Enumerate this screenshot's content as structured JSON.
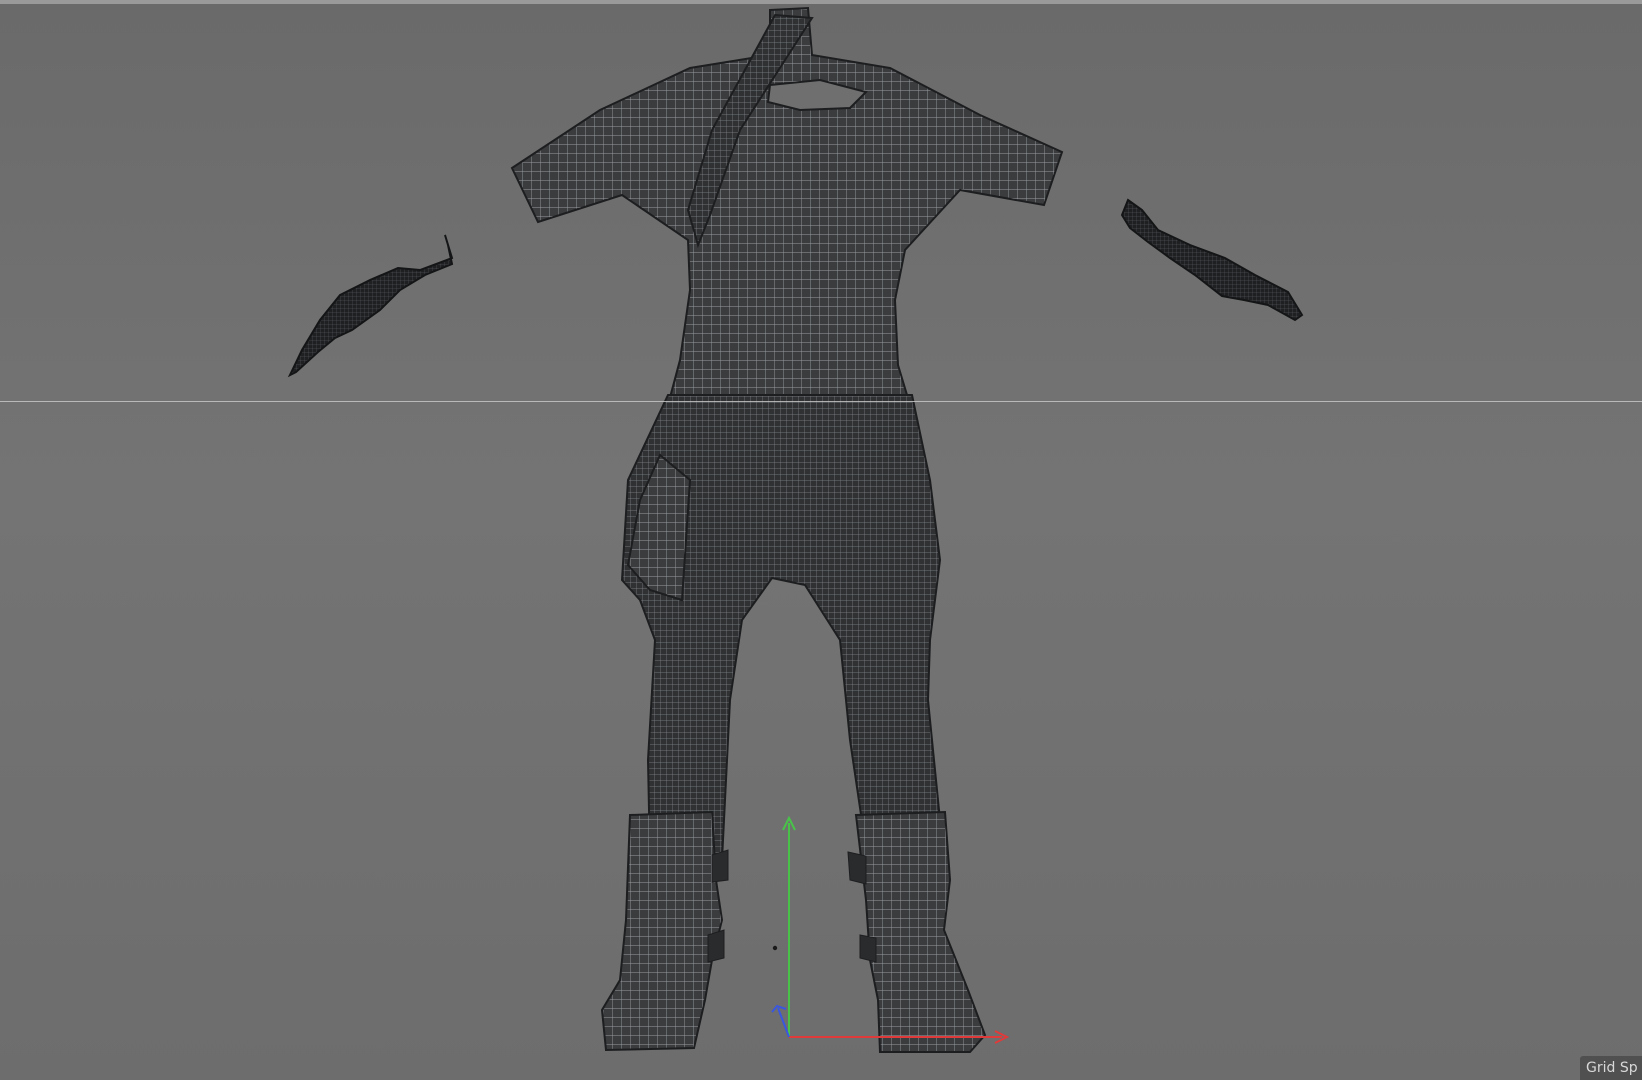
{
  "viewport": {
    "status_label": "Grid Sp",
    "background_color": "#6d6d6d"
  },
  "scene": {
    "model": "garment-wireframe",
    "parts": [
      "top",
      "scarf",
      "pants",
      "left-glove",
      "right-glove",
      "left-boot",
      "right-boot"
    ],
    "mesh_color": "#3a3c3e",
    "wire_color": "#b9bcc0"
  },
  "axis_gizmo": {
    "x_color": "#e03a3a",
    "y_color": "#49c24a",
    "z_color": "#3a57e0"
  }
}
